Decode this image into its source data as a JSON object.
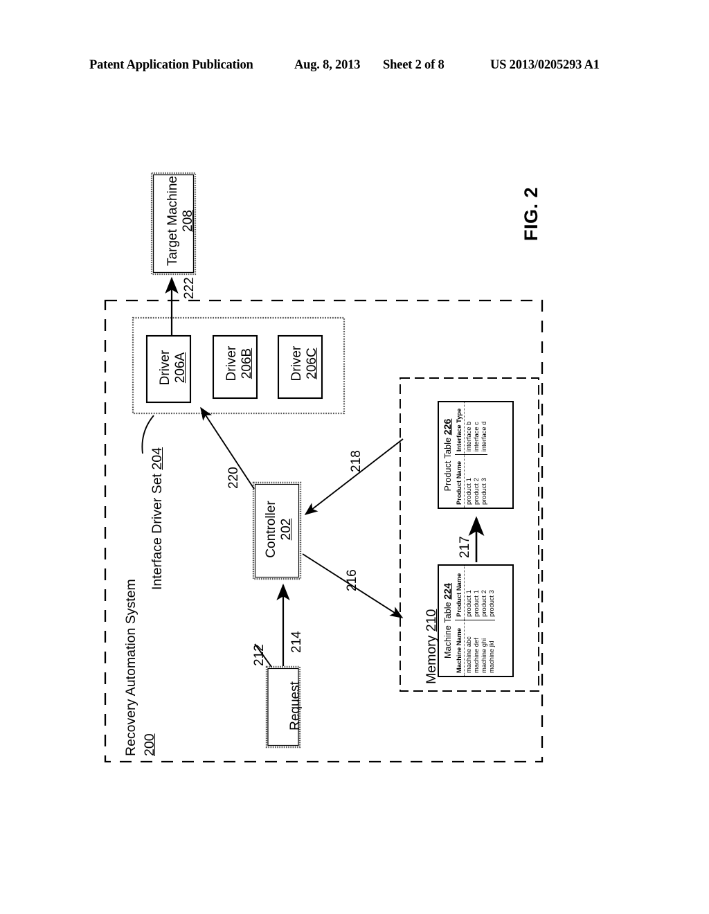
{
  "header": {
    "publication": "Patent Application Publication",
    "date": "Aug. 8, 2013",
    "sheet": "Sheet 2 of 8",
    "number": "US 2013/0205293 A1"
  },
  "figure": {
    "label": "FIG. 2",
    "system": {
      "name": "Recovery Automation System",
      "number": "200"
    },
    "target_machine": {
      "name": "Target Machine",
      "number": "208"
    },
    "driver_set": {
      "name": "Interface Driver Set",
      "number": "204"
    },
    "drivers": [
      {
        "name": "Driver",
        "number": "206A"
      },
      {
        "name": "Driver",
        "number": "206B"
      },
      {
        "name": "Driver",
        "number": "206C"
      }
    ],
    "controller": {
      "name": "Controller",
      "number": "202"
    },
    "request": {
      "name": "Request"
    },
    "memory": {
      "name": "Memory",
      "number": "210"
    },
    "machine_table": {
      "title": "Machine Table",
      "number": "224",
      "columns": [
        "Machine Name",
        "Product Name"
      ],
      "rows": [
        [
          "machine abc",
          "product 1"
        ],
        [
          "machine def",
          "product 1"
        ],
        [
          "machine ghi",
          "product 2"
        ],
        [
          "machine jkl",
          "product 3"
        ]
      ]
    },
    "product_table": {
      "title": "Product Table",
      "number": "226",
      "columns": [
        "Product Name",
        "Interface Type"
      ],
      "rows": [
        [
          "product 1",
          "interface b"
        ],
        [
          "product 2",
          "interface c"
        ],
        [
          "product 3",
          "interface d"
        ]
      ]
    },
    "reference_numerals": {
      "r212": "212",
      "r214": "214",
      "r216": "216",
      "r217": "217",
      "r218": "218",
      "r220": "220",
      "r222": "222"
    }
  }
}
